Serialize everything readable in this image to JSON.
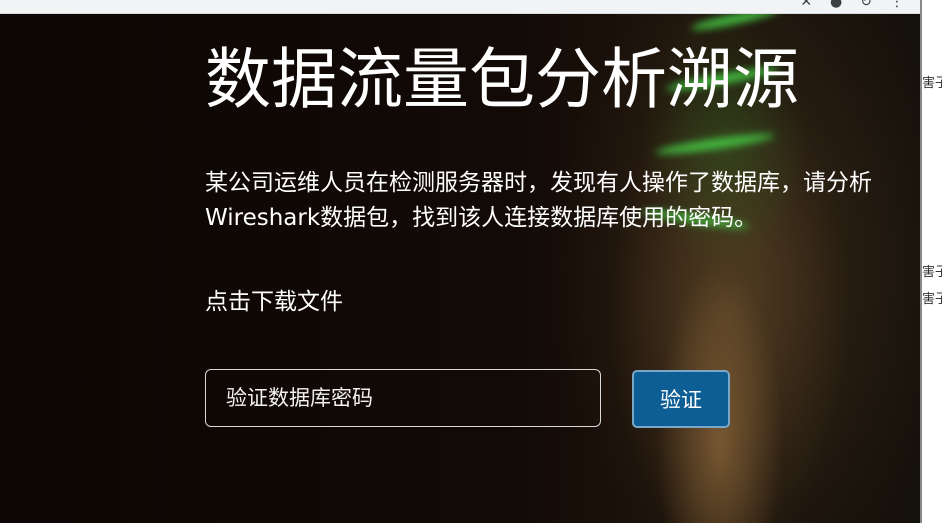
{
  "browser": {
    "icons": [
      "close-icon",
      "info-icon",
      "refresh-icon",
      "menu-icon"
    ]
  },
  "hero": {
    "title": "数据流量包分析溯源",
    "description": "某公司运维人员在检测服务器时，发现有人操作了数据库，请分析Wireshark数据包，找到该人连接数据库使用的密码。",
    "download_link": "点击下载文件",
    "password_input": {
      "placeholder": "验证数据库密码",
      "value": ""
    },
    "verify_button": "验证",
    "colors": {
      "background": "#0c0604",
      "button": "#0d5e95",
      "text": "#ffffff",
      "glow": "#46d246"
    }
  },
  "right_panel": {
    "fragments": [
      "害子",
      "害子",
      "害子"
    ]
  }
}
